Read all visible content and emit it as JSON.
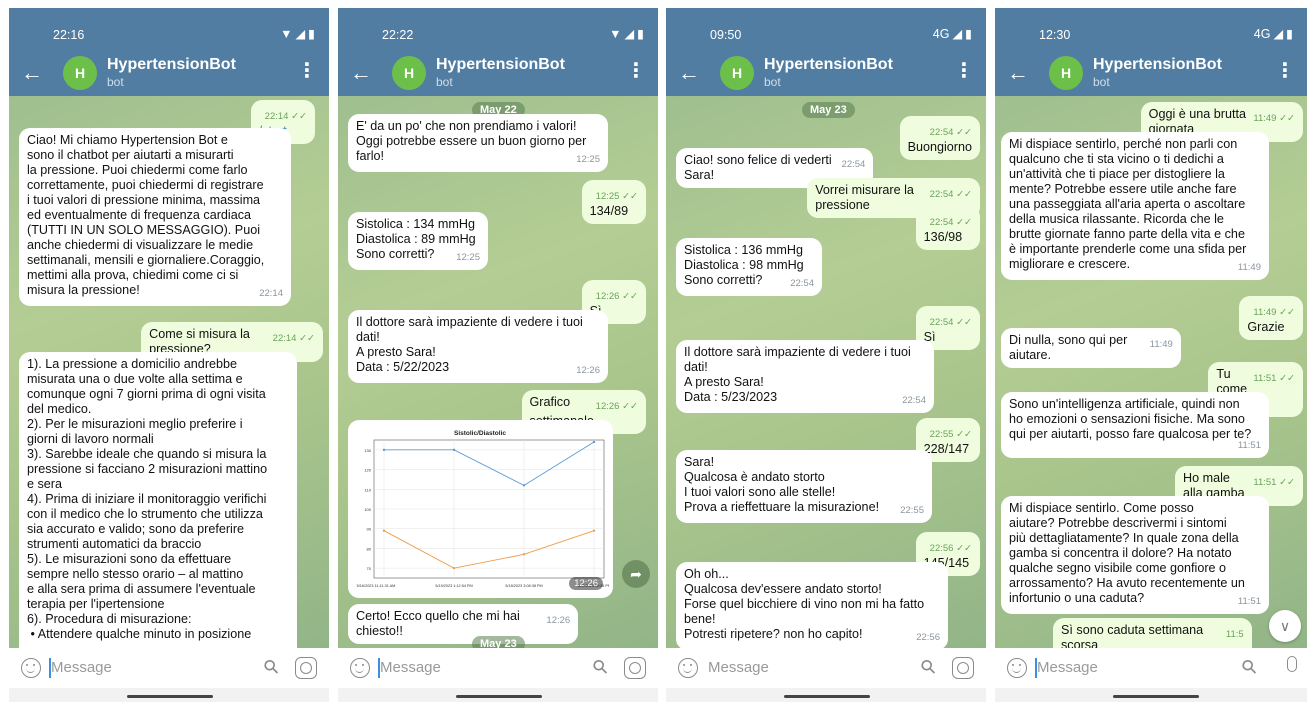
{
  "app": {
    "title": "HypertensionBot",
    "subtitle": "bot",
    "avatar_letter": "H",
    "input_placeholder": "Message"
  },
  "colors": {
    "header": "#517da2",
    "outgoing": "#effdde",
    "incoming": "#ffffff",
    "avatar": "#6cc04a"
  },
  "phones": [
    {
      "time": "22:16",
      "signal": "",
      "messages": [
        {
          "dir": "out",
          "text": "/start",
          "time": "22:14"
        },
        {
          "dir": "in",
          "text": "Ciao! Mi chiamo Hypertension Bot e\nsono il chatbot per aiutarti a misurarti\nla pressione. Puoi chiedermi come farlo\ncorrettamente, puoi chiedermi di registrare\ni tuoi valori di pressione minima, massima\ned eventualmente di frequenza cardiaca\n(TUTTI IN UN SOLO MESSAGGIO). Puoi\nanche chiedermi di visualizzare le medie\nsettimanali, mensili e giornaliere.Coraggio,\nmettimi alla prova, chiedimi come ci si\nmisura la pressione!",
          "time": "22:14"
        },
        {
          "dir": "out",
          "text": "Come si misura la pressione?",
          "time": "22:14"
        },
        {
          "dir": "in",
          "text": "1). La pressione a domicilio andrebbe\nmisurata una o due volte alla settima e\ncomunque ogni 7 giorni prima di ogni visita\ndel medico.\n2). Per le misurazioni meglio preferire i\ngiorni di lavoro normali\n3). Sarebbe ideale che quando si misura la\npressione si facciano 2 misurazioni mattino\ne sera\n4). Prima di iniziare il monitoraggio verifichi\ncon il medico che lo strumento che utilizza\nsia accurato e valido; sono da preferire\nstrumenti automatici da braccio\n5). Le misurazioni sono da effettuare\nsempre nello stesso orario – al mattino\ne alla sera prima di assumere l'eventuale\nterapia per l'ipertensione\n6). Procedura di misurazione:\n • Attendere qualche minuto in posizione",
          "time": ""
        }
      ]
    },
    {
      "time": "22:22",
      "signal": "",
      "date_top": "May 22",
      "date_bottom": "May 23",
      "messages": [
        {
          "dir": "in",
          "text": "E' da un po' che non prendiamo i valori!\nOggi potrebbe essere un buon giorno per\nfarlo!",
          "time": "12:25"
        },
        {
          "dir": "out",
          "text": "134/89",
          "time": "12:25"
        },
        {
          "dir": "in",
          "text": "Sistolica : 134 mmHg\nDiastolica : 89 mmHg\nSono corretti?",
          "time": "12:25"
        },
        {
          "dir": "out",
          "text": "Sì",
          "time": "12:26"
        },
        {
          "dir": "in",
          "text": "Il dottore sarà impaziente di vedere i tuoi\ndati!\nA presto Sara!\nData : 5/22/2023",
          "time": "12:26"
        },
        {
          "dir": "out",
          "text": "Grafico settimanale",
          "time": "12:26"
        },
        {
          "dir": "in",
          "text": "Certo! Ecco quello che mi hai chiesto!!",
          "time": "12:26"
        }
      ]
    },
    {
      "time": "09:50",
      "signal": "4G",
      "date_top": "May 23",
      "messages": [
        {
          "dir": "out",
          "text": "Buongiorno",
          "time": "22:54"
        },
        {
          "dir": "in",
          "text": "Ciao! sono felice di vederti Sara!",
          "time": "22:54"
        },
        {
          "dir": "out",
          "text": "Vorrei misurare la pressione",
          "time": "22:54"
        },
        {
          "dir": "out",
          "text": "136/98",
          "time": "22:54"
        },
        {
          "dir": "in",
          "text": "Sistolica : 136 mmHg\nDiastolica : 98 mmHg\nSono corretti?",
          "time": "22:54"
        },
        {
          "dir": "out",
          "text": "Sì",
          "time": "22:54"
        },
        {
          "dir": "in",
          "text": "Il dottore sarà impaziente di vedere i tuoi\ndati!\nA presto Sara!\nData : 5/23/2023",
          "time": "22:54"
        },
        {
          "dir": "out",
          "text": "228/147",
          "time": "22:55"
        },
        {
          "dir": "in",
          "text": "Sara!\nQualcosa è andato storto\nI tuoi valori sono alle stelle!\nProva a rieffettuare la misurazione!",
          "time": "22:55"
        },
        {
          "dir": "out",
          "text": "145/145",
          "time": "22:56"
        },
        {
          "dir": "in",
          "text": "Oh oh...\nQualcosa dev'essere andato storto!\nForse quel bicchiere di vino non mi ha fatto\nbene!\nPotresti ripetere? non ho capito!",
          "time": "22:56"
        }
      ]
    },
    {
      "time": "12:30",
      "signal": "4G",
      "messages": [
        {
          "dir": "out",
          "text": "Oggi è una brutta giornata",
          "time": "11:49"
        },
        {
          "dir": "in",
          "text": "Mi dispiace sentirlo, perché non parli con\nqualcuno che ti sta vicino o ti dedichi a\nun'attività che ti piace per distogliere la\nmente? Potrebbe essere utile anche fare\nuna passeggiata all'aria aperta o ascoltare\ndella musica rilassante. Ricorda che le\nbrutte giornate fanno parte della vita e che\nè importante prenderle come una sfida per\nmigliorare e crescere.",
          "time": "11:49"
        },
        {
          "dir": "out",
          "text": "Grazie",
          "time": "11:49"
        },
        {
          "dir": "in",
          "text": "Di nulla, sono qui per aiutare.",
          "time": "11:49"
        },
        {
          "dir": "out",
          "text": "Tu come stai?",
          "time": "11:51"
        },
        {
          "dir": "in",
          "text": "Sono un'intelligenza artificiale, quindi non\nho emozioni o sensazioni fisiche. Ma sono\nqui per aiutarti, posso fare qualcosa per te?",
          "time": "11:51"
        },
        {
          "dir": "out",
          "text": "Ho male alla gamba",
          "time": "11:51"
        },
        {
          "dir": "in",
          "text": "Mi dispiace sentirlo. Come posso\naiutare? Potrebbe descrivermi i sintomi\npiù dettagliatamente? In quale zona della\ngamba si concentra il dolore? Ha notato\nqualche segno visibile come gonfiore o\narrossamento? Ha avuto recentemente un\ninfortunio o una caduta?",
          "time": "11:51"
        },
        {
          "dir": "out",
          "text": "Sì sono caduta settimana scorsa",
          "time": "11:5"
        }
      ]
    }
  ],
  "chart_data": {
    "type": "line",
    "title": "Sistolic/Diastolic",
    "x": [
      "5/16/2023 11:11:31 AM",
      "5/19/2023 1:12:54 PM",
      "5/18/2023 3:08:38 PM",
      "5/22/2023 12:26 PM"
    ],
    "series": [
      {
        "values": [
          130,
          130,
          112,
          134
        ],
        "color": "#5b9bd5"
      },
      {
        "values": [
          89,
          70,
          77,
          89
        ],
        "color": "#ed9c4a"
      }
    ],
    "ylim": [
      65,
      135
    ],
    "yticks": [
      70,
      80,
      90,
      100,
      110,
      120,
      130
    ],
    "time_label": "12:26"
  }
}
